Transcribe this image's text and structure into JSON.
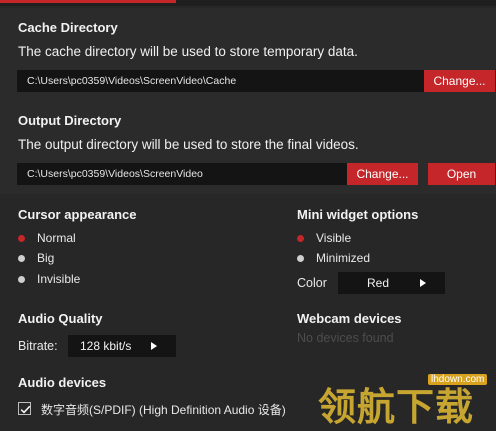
{
  "cache": {
    "heading": "Cache Directory",
    "description": "The cache directory will be used to store temporary data.",
    "path": "C:\\Users\\pc0359\\Videos\\ScreenVideo\\Cache",
    "change_label": "Change..."
  },
  "output": {
    "heading": "Output Directory",
    "description": "The output directory will be used to store the final videos.",
    "path": "C:\\Users\\pc0359\\Videos\\ScreenVideo",
    "change_label": "Change...",
    "open_label": "Open"
  },
  "cursor": {
    "heading": "Cursor appearance",
    "options": [
      "Normal",
      "Big",
      "Invisible"
    ],
    "selected": "Normal"
  },
  "mini_widget": {
    "heading": "Mini widget options",
    "options": [
      "Visible",
      "Minimized"
    ],
    "selected": "Visible",
    "color_label": "Color",
    "color_value": "Red"
  },
  "audio_quality": {
    "heading": "Audio Quality",
    "bitrate_label": "Bitrate:",
    "bitrate_value": "128 kbit/s"
  },
  "webcam": {
    "heading": "Webcam devices",
    "empty_text": "No devices found"
  },
  "audio_devices": {
    "heading": "Audio devices",
    "items": [
      {
        "label": "数字音频(S/PDIF) (High Definition Audio 设备)",
        "checked": true
      }
    ]
  },
  "watermark": {
    "text": "领航下载",
    "url": "lhdown.com"
  },
  "colors": {
    "accent": "#c4262a",
    "background": "#272727",
    "field": "#141414"
  }
}
